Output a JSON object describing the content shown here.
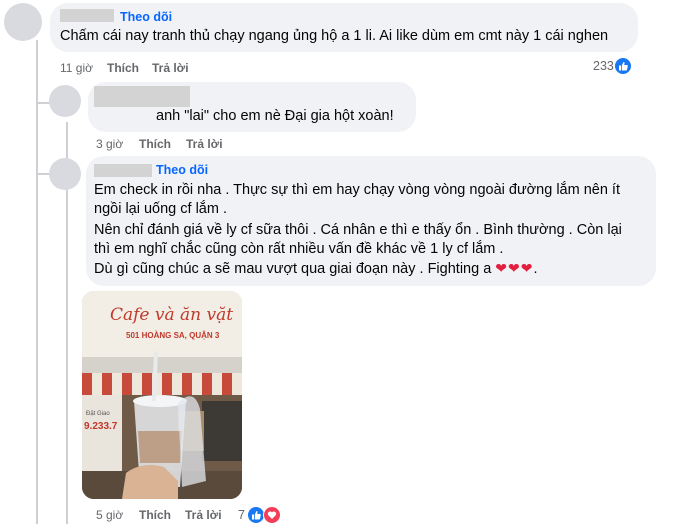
{
  "comments": [
    {
      "follow_label": "Theo dõi",
      "text": "Chấm cái nay tranh thủ chạy ngang ủng hộ a 1 li. Ai like dùm em cmt này 1 cái nghen",
      "time": "11 giờ",
      "like_label": "Thích",
      "reply_label": "Trả lời",
      "reaction_count": "233"
    },
    {
      "text": "anh \"lai\" cho em nè Đại gia hột xoàn!",
      "time": "3 giờ",
      "like_label": "Thích",
      "reply_label": "Trả lời"
    },
    {
      "follow_label": "Theo dõi",
      "lines": [
        "Em check in rồi nha . Thực sự thì em hay chạy vòng vòng ngoài đường lắm nên ít",
        "ngồi lại uống cf lắm .",
        "Nên chỉ đánh giá về ly cf sữa thôi . Cá nhân e thì e thấy ổn . Bình thường . Còn lại",
        "thì em nghĩ chắc cũng còn rất nhiều vấn đề khác về 1 ly cf lắm .",
        "Dù gì cũng chúc a sẽ mau vượt qua giai đoạn này . Fighting a"
      ],
      "hearts": "❤❤❤",
      "trailing": ".",
      "photo": {
        "sign_text": "Cafe và ăn vặt",
        "address": "501 HOÀNG SA, QUẬN 3",
        "sign_small_1": "Đặt Giao ",
        "sign_small_2": "9.233.7"
      },
      "time": "5 giờ",
      "like_label": "Thích",
      "reply_label": "Trả lời",
      "reaction_count": "7"
    }
  ],
  "colors": {
    "bubble": "#f0f2f5",
    "link": "#0866ff",
    "meta": "#65676b",
    "like": "#1877f2",
    "love": "#f33e58",
    "heart": "#e41e3f"
  }
}
